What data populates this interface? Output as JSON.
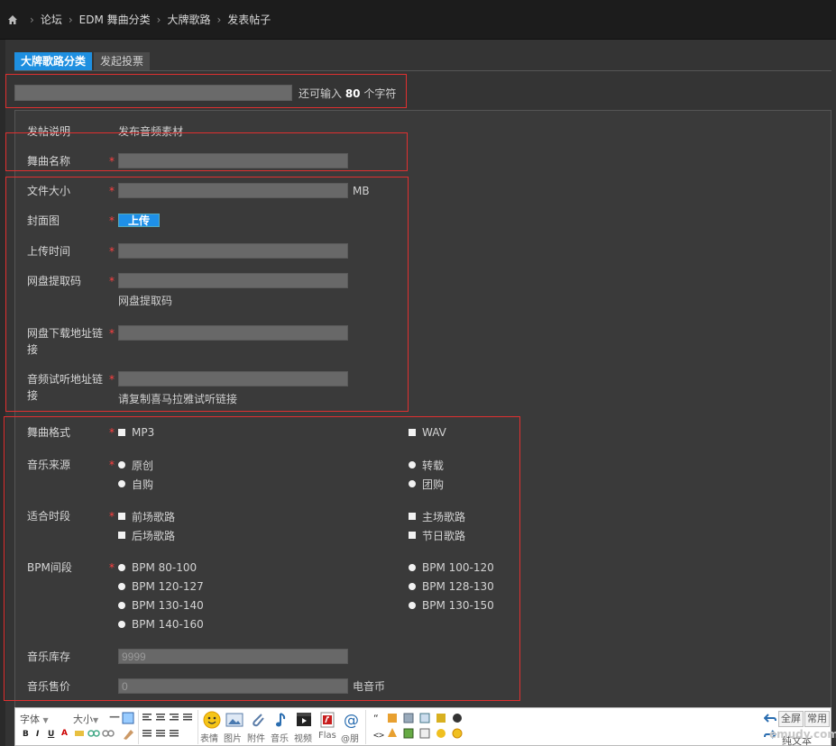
{
  "breadcrumb": {
    "items": [
      "论坛",
      "EDM 舞曲分类",
      "大牌歌路",
      "发表帖子"
    ]
  },
  "tabs": [
    {
      "label": "大牌歌路分类",
      "active": true
    },
    {
      "label": "发起投票",
      "active": false
    }
  ],
  "title_field": {
    "value": "",
    "hint_prefix": "还可输入 ",
    "hint_count": "80",
    "hint_suffix": " 个字符"
  },
  "form": {
    "post_note": {
      "label": "发帖说明",
      "value": "发布音频素材"
    },
    "track_name": {
      "label": "舞曲名称",
      "required": "*",
      "value": ""
    },
    "file_size": {
      "label": "文件大小",
      "required": "*",
      "value": "",
      "unit": "MB"
    },
    "cover": {
      "label": "封面图",
      "required": "*",
      "button": "上传"
    },
    "upload_time": {
      "label": "上传时间",
      "required": "*",
      "value": ""
    },
    "pan_code": {
      "label": "网盘提取码",
      "required": "*",
      "value": "",
      "hint": "网盘提取码"
    },
    "pan_link": {
      "label_line1": "网盘下载地址链",
      "label_line2": "接",
      "required": "*",
      "value": ""
    },
    "preview_link": {
      "label_line1": "音频试听地址链",
      "label_line2": "接",
      "required": "*",
      "value": "",
      "hint": "请复制喜马拉雅试听链接"
    },
    "format": {
      "label": "舞曲格式",
      "required": "*",
      "options": [
        "MP3",
        "WAV"
      ]
    },
    "source": {
      "label": "音乐来源",
      "required": "*",
      "options": [
        "原创",
        "转载",
        "自购",
        "团购"
      ]
    },
    "period": {
      "label": "适合时段",
      "required": "*",
      "options": [
        "前场歌路",
        "主场歌路",
        "后场歌路",
        "节日歌路"
      ]
    },
    "bpm": {
      "label": "BPM间段",
      "required": "*",
      "options": [
        "BPM 80-100",
        "BPM 100-120",
        "BPM 120-127",
        "BPM 128-130",
        "BPM 130-140",
        "BPM 130-150",
        "BPM 140-160"
      ]
    },
    "stock": {
      "label": "音乐库存",
      "value": "9999"
    },
    "price": {
      "label": "音乐售价",
      "value": "0",
      "unit": "电音币"
    }
  },
  "editor": {
    "font_select": "字体",
    "size_select": "大小",
    "labels": [
      "表情",
      "图片",
      "附件",
      "音乐",
      "视频",
      "Flas",
      "@朋"
    ],
    "fullscreen": "全屏",
    "common": "常用",
    "plain_text": "纯文本",
    "watermark": "emudy.com"
  },
  "colors": {
    "accent": "#1e8fe0",
    "required": "#ff4040",
    "highlight_box": "#e03030"
  }
}
